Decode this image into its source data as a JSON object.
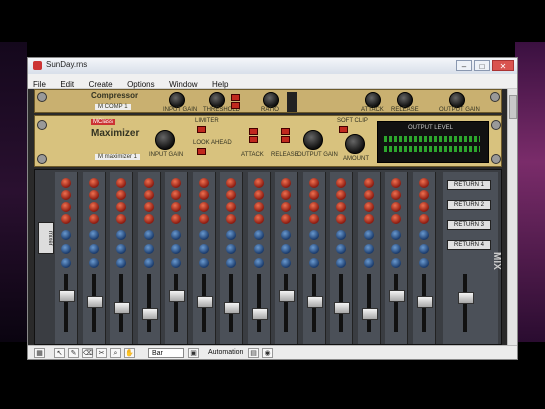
{
  "window": {
    "title": "SunDay.rns",
    "min": "–",
    "max": "□",
    "close": "✕"
  },
  "menu": [
    "File",
    "Edit",
    "Create",
    "Options",
    "Window",
    "Help"
  ],
  "rack1": {
    "name": "Compressor",
    "sub": "M COMP 1",
    "labels": [
      "INPUT GAIN",
      "THRESHOLD",
      "RATIO",
      "ATTACK",
      "RELEASE",
      "OUTPUT GAIN"
    ]
  },
  "rack2": {
    "brand": "MClass",
    "name": "Maximizer",
    "sub": "M maximizer 1",
    "labels": [
      "INPUT GAIN",
      "LIMITER",
      "LOOK AHEAD",
      "ATTACK",
      "RELEASE",
      "OUTPUT GAIN",
      "SOFT CLIP",
      "AMOUNT"
    ],
    "display": "OUTPUT LEVEL"
  },
  "mixer": {
    "side_label": "mixer",
    "logo": "MIX",
    "master_buttons": [
      "RETURN 1",
      "RETURN 2",
      "RETURN 3",
      "RETURN 4"
    ],
    "channels": 14
  },
  "toolbar": {
    "select": "Bar",
    "automation": "Automation"
  },
  "colors": {
    "rack_gold": "#c9b070",
    "mixer": "#3a3d42",
    "knob_red": "#d04830",
    "knob_blue": "#3a6aa8"
  }
}
